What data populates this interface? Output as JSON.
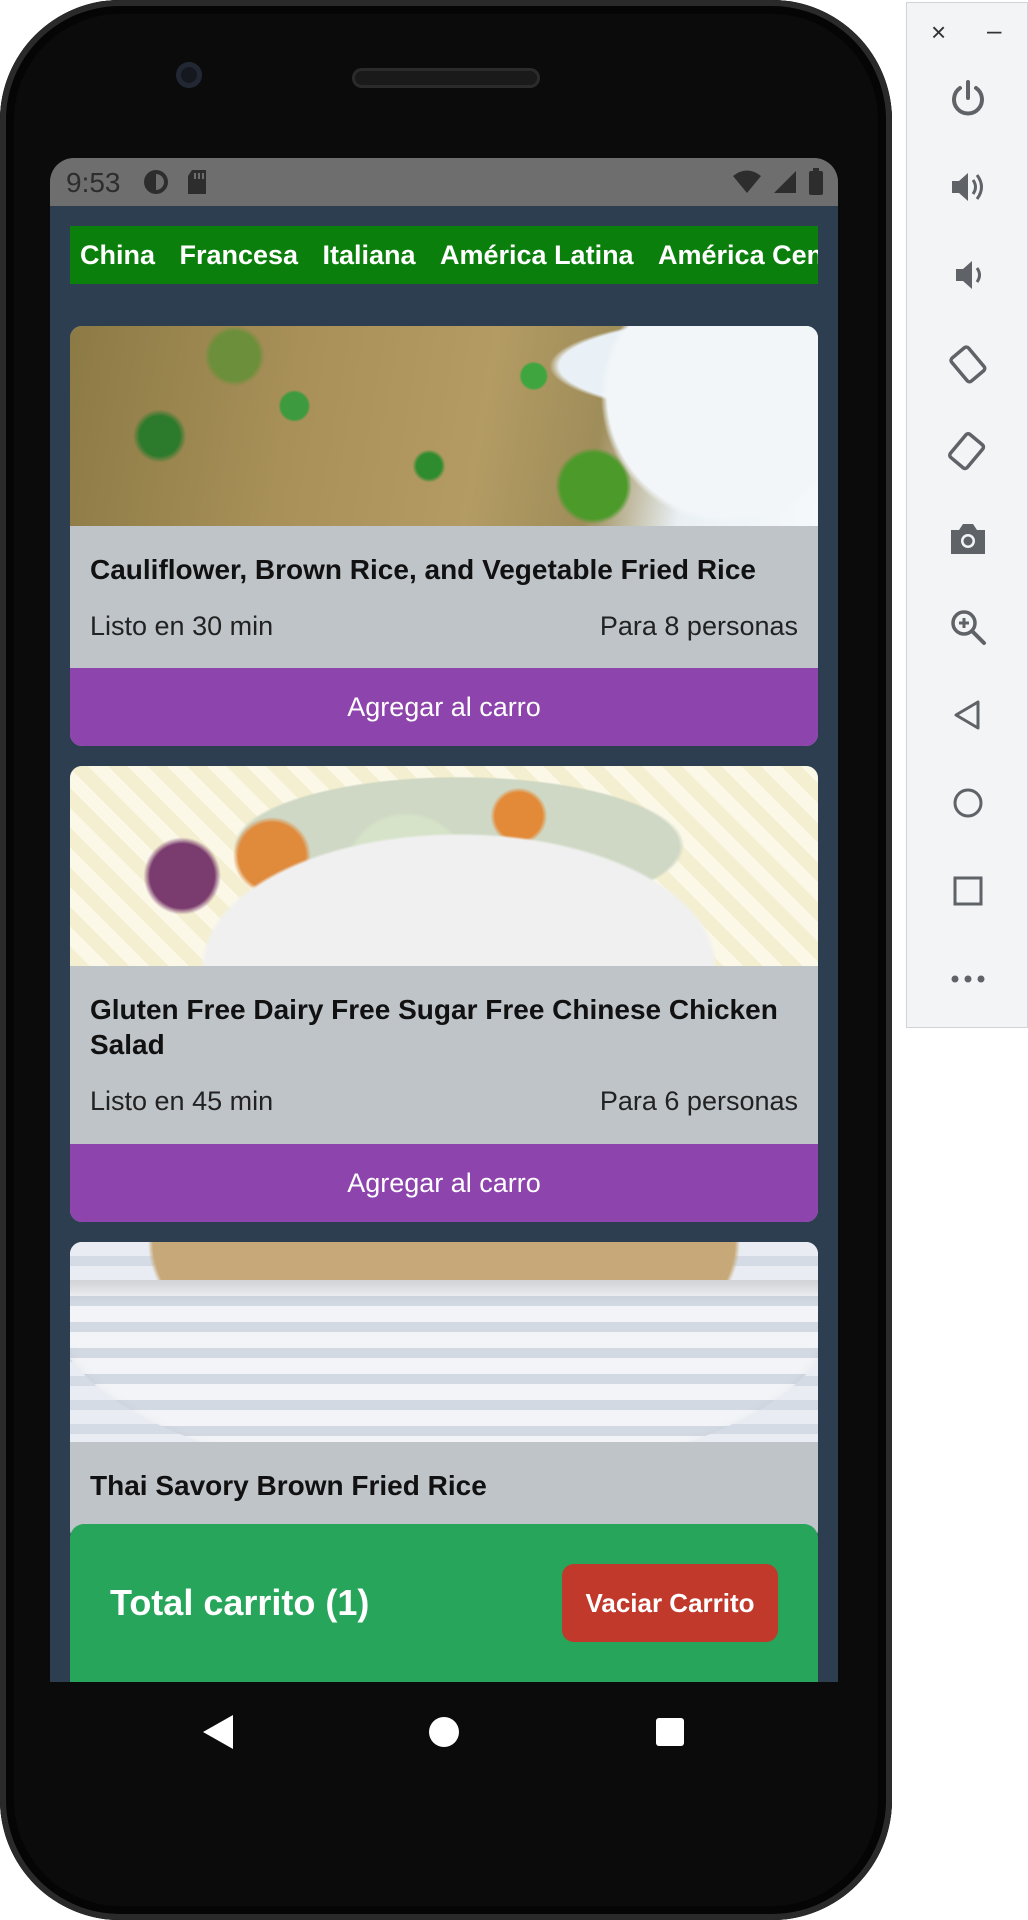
{
  "status_bar": {
    "time": "9:53",
    "icons_left": [
      "data-saver-icon",
      "sd-card-icon"
    ],
    "icons_right": [
      "wifi-icon",
      "signal-icon",
      "battery-icon"
    ]
  },
  "categories": [
    "China",
    "Francesa",
    "Italiana",
    "América Latina",
    "América Central"
  ],
  "recipes": [
    {
      "title": "Cauliflower, Brown Rice, and Vegetable Fried Rice",
      "ready": "Listo en 30 min",
      "servings": "Para 8 personas",
      "button": "Agregar al carro"
    },
    {
      "title": "Gluten Free Dairy Free Sugar Free Chinese Chicken Salad",
      "ready": "Listo en 45 min",
      "servings": "Para 6 personas",
      "button": "Agregar al carro"
    },
    {
      "title": "Thai Savory Brown Fried Rice"
    }
  ],
  "cart": {
    "total_label": "Total carrito (1)",
    "empty_button": "Vaciar Carrito"
  },
  "colors": {
    "screen_bg": "#2c3e50",
    "category_bar": "#0b7f0b",
    "add_button": "#8e44ad",
    "cart_bar": "#27a55a",
    "empty_button": "#c0392b",
    "card_bg": "#bfc4c9"
  },
  "emulator_panel": {
    "window_controls": [
      "close-icon",
      "minimize-icon"
    ],
    "buttons": [
      "power-icon",
      "volume-up-icon",
      "volume-down-icon",
      "rotate-left-icon",
      "rotate-right-icon",
      "camera-icon",
      "zoom-icon",
      "back-icon",
      "home-icon",
      "overview-icon",
      "more-icon"
    ]
  },
  "nav_bar": [
    "back-icon",
    "home-icon",
    "recents-icon"
  ]
}
